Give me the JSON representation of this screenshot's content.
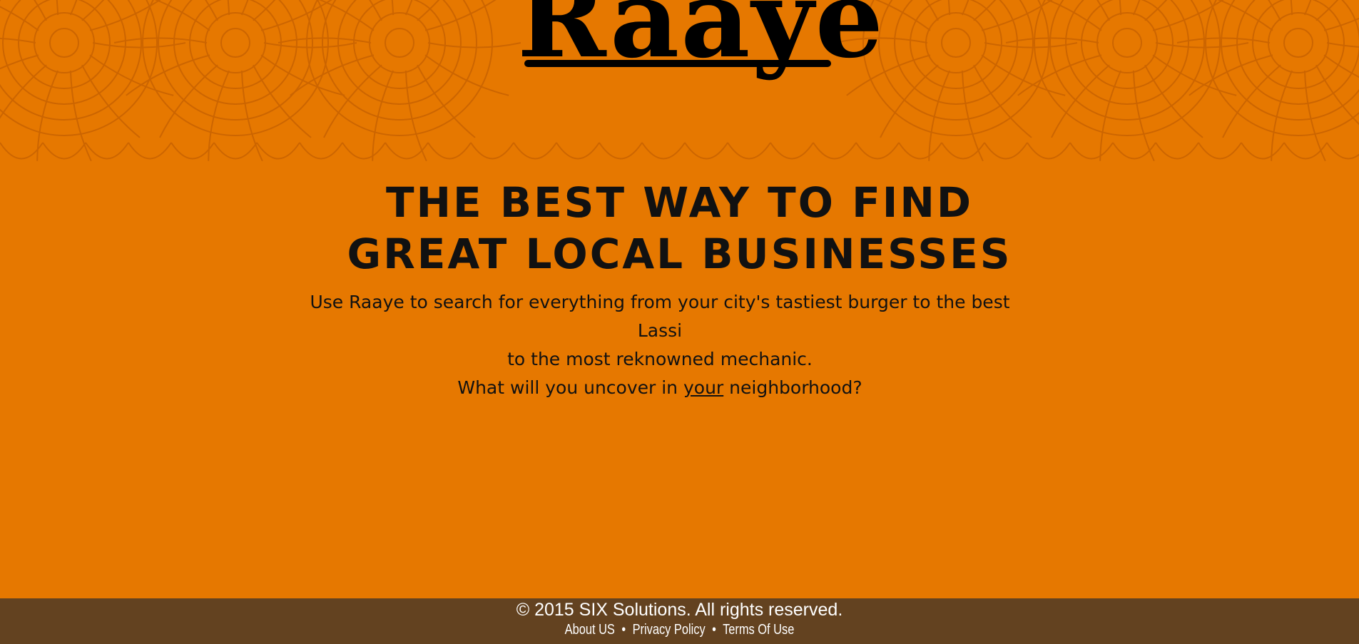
{
  "brand": {
    "logo_text": "Raayë"
  },
  "hero": {
    "headline_line1": "The best way to find",
    "headline_line2": "Great local businesses",
    "intro_part1": "Use Raaye to search for everything from your city's tastiest burger to the best Lassi",
    "intro_part2": "to the most reknowned mechanic.",
    "question_prefix": "What will you uncover in ",
    "question_emphasis": "your",
    "question_suffix": " neighborhood?"
  },
  "footer": {
    "copyright": "© 2015 SIX Solutions. All rights reserved.",
    "links": {
      "about": "About US",
      "privacy": "Privacy Policy",
      "terms": "Terms Of Use"
    },
    "separator": "•"
  },
  "colors": {
    "background": "#e67800",
    "pattern": "#c86200",
    "footer": "#634220",
    "text": "#111111",
    "footer_text": "#ffffff"
  }
}
